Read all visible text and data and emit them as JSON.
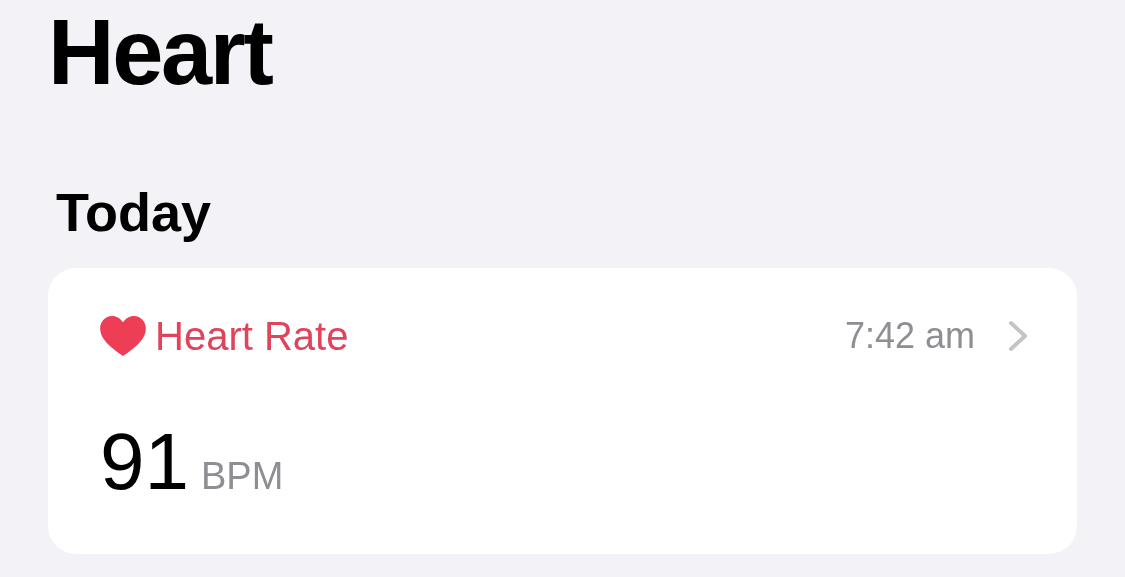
{
  "title": "Heart",
  "section": {
    "title": "Today",
    "card": {
      "label": "Heart Rate",
      "time": "7:42 am",
      "value": "91",
      "unit": "BPM"
    }
  }
}
